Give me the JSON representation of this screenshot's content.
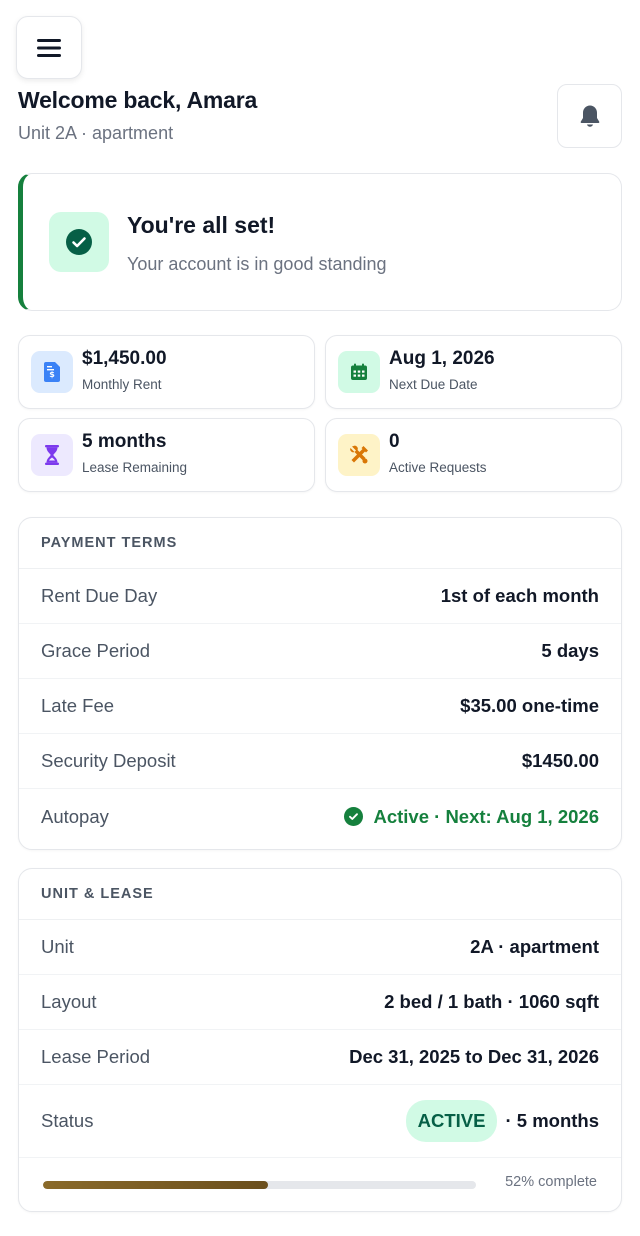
{
  "header": {
    "greeting": "Welcome back, Amara",
    "subtitle": "Unit 2A · apartment",
    "menu_icon": "hamburger-icon",
    "notification_icon": "bell-icon"
  },
  "status": {
    "title": "You're all set!",
    "message": "Your account is in good standing",
    "icon": "check-circle-icon",
    "accent_color": "#15803d"
  },
  "stats": [
    {
      "value": "$1,450.00",
      "label": "Monthly Rent",
      "icon": "receipt-icon",
      "color": "#3b82f6",
      "bg": "#dbeafe"
    },
    {
      "value": "Aug 1, 2026",
      "label": "Next Due Date",
      "icon": "calendar-icon",
      "color": "#15803d",
      "bg": "#d1fae5"
    },
    {
      "value": "5 months",
      "label": "Lease Remaining",
      "icon": "hourglass-icon",
      "color": "#7c3aed",
      "bg": "#ede9fe"
    },
    {
      "value": "0",
      "label": "Active Requests",
      "icon": "tools-icon",
      "color": "#d97706",
      "bg": "#fef3c7"
    }
  ],
  "payment_terms": {
    "heading": "PAYMENT TERMS",
    "rows": [
      {
        "label": "Rent Due Day",
        "value": "1st of each month"
      },
      {
        "label": "Grace Period",
        "value": "5 days"
      },
      {
        "label": "Late Fee",
        "value": "$35.00 one-time"
      },
      {
        "label": "Security Deposit",
        "value": "$1450.00"
      },
      {
        "label": "Autopay",
        "value": "Active · Next: Aug 1, 2026"
      }
    ]
  },
  "unit_lease": {
    "heading": "UNIT & LEASE",
    "rows": [
      {
        "label": "Unit",
        "value": "2A · apartment"
      },
      {
        "label": "Layout",
        "value": "2 bed / 1 bath · 1060 sqft"
      },
      {
        "label": "Lease Period",
        "value": "Dec 31, 2025 to Dec 31, 2026"
      },
      {
        "label": "Status",
        "badge": "ACTIVE",
        "value": "· 5 months"
      }
    ],
    "progress_percent": 52,
    "progress_text": "52% complete"
  }
}
